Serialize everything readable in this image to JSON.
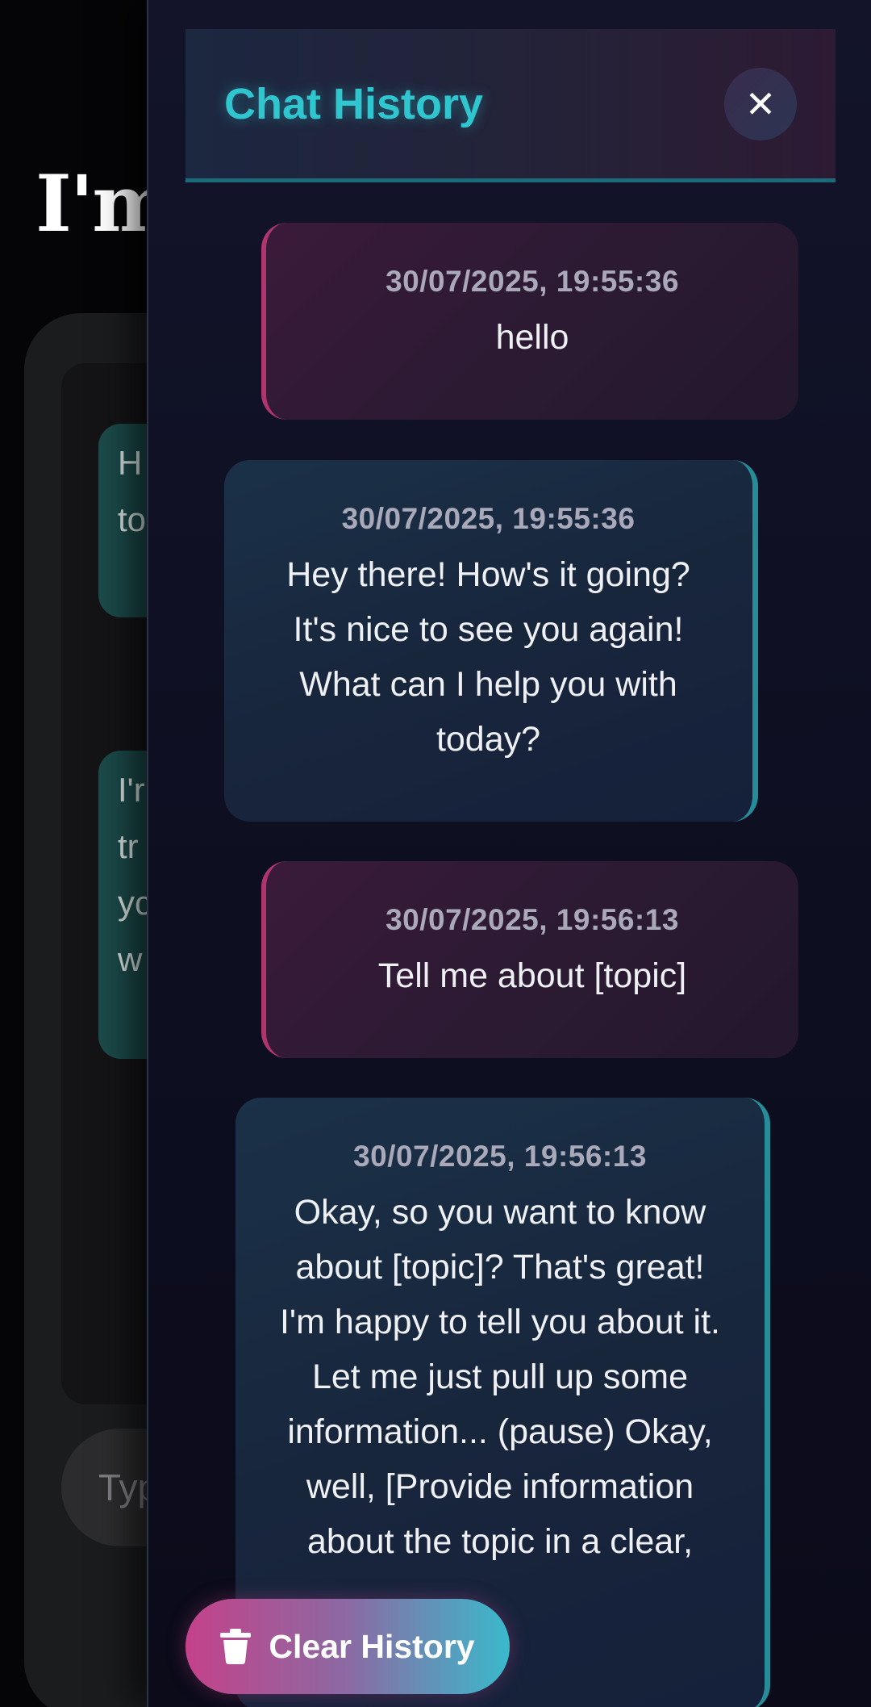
{
  "background": {
    "heading": "I'm",
    "bubbles": [
      {
        "lines": [
          "H",
          "to"
        ]
      },
      {
        "lines": [
          "I'r",
          "tr",
          "yc",
          "w"
        ]
      }
    ],
    "input_placeholder": "Typ"
  },
  "history": {
    "title": "Chat History",
    "close_icon": "close-icon",
    "clear_label": "Clear History",
    "clear_icon": "trash-icon",
    "messages": [
      {
        "role": "user",
        "timestamp": "30/07/2025, 19:55:36",
        "text": "hello"
      },
      {
        "role": "bot",
        "timestamp": "30/07/2025, 19:55:36",
        "text": "Hey there! How's it going? It's nice to see you again! What can I help you with today?"
      },
      {
        "role": "user",
        "timestamp": "30/07/2025, 19:56:13",
        "text": "Tell me about [topic]"
      },
      {
        "role": "bot",
        "timestamp": "30/07/2025, 19:56:13",
        "text": "Okay, so you want to know about [topic]? That's great! I'm happy to tell you about it. Let me just pull up some information... (pause) Okay, well, [Provide information about the topic in a clear,"
      }
    ]
  },
  "colors": {
    "accent_cyan": "#2fc6cf",
    "accent_pink": "#b0356e",
    "bot_border": "#268c98"
  }
}
